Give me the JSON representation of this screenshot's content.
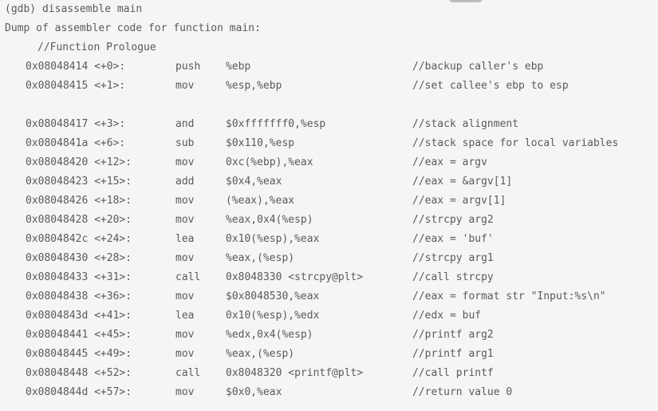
{
  "header": {
    "command": "(gdb) disassemble main",
    "dump": "Dump of assembler code for function main:",
    "section": "//Function Prologue"
  },
  "rows": [
    {
      "addr": "0x08048414 <+0>:",
      "op": "push",
      "args": "%ebp",
      "cmt": "//backup caller's ebp"
    },
    {
      "addr": "0x08048415 <+1>:",
      "op": "mov",
      "args": "%esp,%ebp",
      "cmt": "//set callee's ebp to esp"
    },
    {
      "addr": "0x08048417 <+3>:",
      "op": "and",
      "args": "$0xfffffff0,%esp",
      "cmt": "//stack alignment"
    },
    {
      "addr": "0x0804841a <+6>:",
      "op": "sub",
      "args": "$0x110,%esp",
      "cmt": "//stack space for local variables"
    },
    {
      "addr": "0x08048420 <+12>:",
      "op": "mov",
      "args": "0xc(%ebp),%eax",
      "cmt": "//eax = argv"
    },
    {
      "addr": "0x08048423 <+15>:",
      "op": "add",
      "args": "$0x4,%eax",
      "cmt": "//eax = &argv[1]"
    },
    {
      "addr": "0x08048426 <+18>:",
      "op": "mov",
      "args": "(%eax),%eax",
      "cmt": "//eax = argv[1]"
    },
    {
      "addr": "0x08048428 <+20>:",
      "op": "mov",
      "args": "%eax,0x4(%esp)",
      "cmt": "//strcpy arg2"
    },
    {
      "addr": "0x0804842c <+24>:",
      "op": "lea",
      "args": "0x10(%esp),%eax",
      "cmt": "//eax = 'buf'"
    },
    {
      "addr": "0x08048430 <+28>:",
      "op": "mov",
      "args": "%eax,(%esp)",
      "cmt": "//strcpy arg1"
    },
    {
      "addr": "0x08048433 <+31>:",
      "op": "call",
      "args": "0x8048330 <strcpy@plt>",
      "cmt": "//call strcpy"
    },
    {
      "addr": "0x08048438 <+36>:",
      "op": "mov",
      "args": "$0x8048530,%eax",
      "cmt": "//eax = format str \"Input:%s\\n\""
    },
    {
      "addr": "0x0804843d <+41>:",
      "op": "lea",
      "args": "0x10(%esp),%edx",
      "cmt": "//edx = buf"
    },
    {
      "addr": "0x08048441 <+45>:",
      "op": "mov",
      "args": "%edx,0x4(%esp)",
      "cmt": "//printf arg2"
    },
    {
      "addr": "0x08048445 <+49>:",
      "op": "mov",
      "args": "%eax,(%esp)",
      "cmt": "//printf arg1"
    },
    {
      "addr": "0x08048448 <+52>:",
      "op": "call",
      "args": "0x8048320 <printf@plt>",
      "cmt": "//call printf"
    },
    {
      "addr": "0x0804844d <+57>:",
      "op": "mov",
      "args": "$0x0,%eax",
      "cmt": "//return value 0"
    }
  ]
}
